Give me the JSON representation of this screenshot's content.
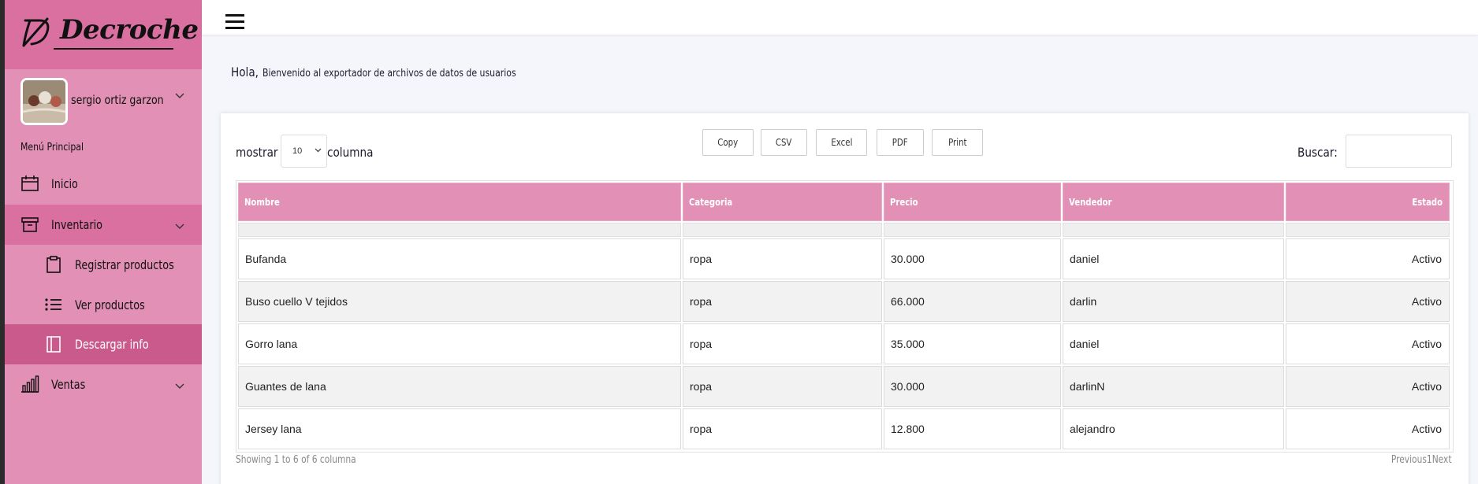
{
  "brand": {
    "name": "Decroche"
  },
  "user": {
    "name": "sergio ortiz garzon"
  },
  "sidebar": {
    "menu_header": "Menú Principal",
    "items": [
      {
        "label": "Inicio",
        "icon": "calendar-icon"
      },
      {
        "label": "Inventario",
        "icon": "archive-icon"
      },
      {
        "label": "Registrar productos",
        "icon": "clipboard-icon"
      },
      {
        "label": "Ver productos",
        "icon": "list-icon"
      },
      {
        "label": "Descargar info",
        "icon": "document-icon"
      },
      {
        "label": "Ventas",
        "icon": "bar-chart-icon"
      }
    ]
  },
  "welcome": {
    "hola": "Hola,",
    "message": "Bienvenido al exportador de archivos de datos de usuarios"
  },
  "table_controls": {
    "show_label": "mostrar",
    "show_value": "10",
    "show_suffix": "columna",
    "search_label": "Buscar:",
    "search_value": "",
    "buttons": [
      "Copy",
      "CSV",
      "Excel",
      "PDF",
      "Print"
    ]
  },
  "table": {
    "columns": [
      "Nombre",
      "Categoria",
      "Precio",
      "Vendedor",
      "Estado"
    ],
    "rows": [
      [
        "Bufanda",
        "ropa",
        "30.000",
        "daniel",
        "Activo"
      ],
      [
        "Buso cuello V tejidos",
        "ropa",
        "66.000",
        "darlin",
        "Activo"
      ],
      [
        "Gorro lana",
        "ropa",
        "35.000",
        "daniel",
        "Activo"
      ],
      [
        "Guantes de lana",
        "ropa",
        "30.000",
        "darlinN",
        "Activo"
      ],
      [
        "Jersey lana",
        "ropa",
        "12.800",
        "alejandro",
        "Activo"
      ]
    ]
  },
  "footer": {
    "info": "Showing 1 to 6 of 6 columna",
    "prev": "Previous",
    "page": "1",
    "next": "Next"
  },
  "colors": {
    "sidebar": "#e290b5",
    "sidebar_dark": "#d9709f",
    "active": "#c95a8b",
    "header_pink": "#e290b5"
  }
}
